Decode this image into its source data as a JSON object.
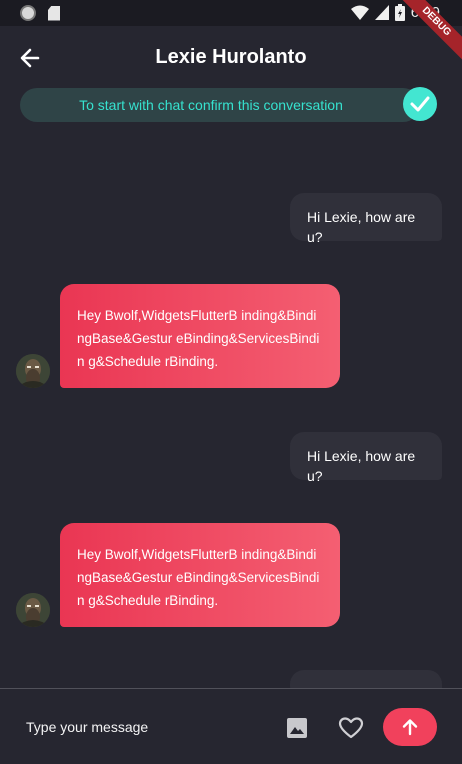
{
  "status_bar": {
    "time": "6:09"
  },
  "debug_banner": "DEBUG",
  "header": {
    "title": "Lexie Hurolanto"
  },
  "confirm_banner": {
    "text": "To start with chat confirm this conversation"
  },
  "messages": [
    {
      "direction": "outgoing",
      "text": "Hi Lexie, how are u?"
    },
    {
      "direction": "incoming",
      "text": "Hey Bwolf,WidgetsFlutterB inding&BindingBase&Gestur eBinding&ServicesBindin g&Schedule rBinding."
    },
    {
      "direction": "outgoing",
      "text": "Hi Lexie, how are u?"
    },
    {
      "direction": "incoming",
      "text": "Hey Bwolf,WidgetsFlutterB inding&BindingBase&Gestur eBinding&ServicesBindin g&Schedule rBinding."
    }
  ],
  "composer": {
    "placeholder": "Type your message"
  },
  "colors": {
    "background": "#262630",
    "outgoing_bubble": "#30303a",
    "incoming_gradient_start": "#ea3653",
    "incoming_gradient_end": "#f45f72",
    "accent_teal": "#43e6d1",
    "send_button": "#f1415c"
  },
  "icons": {
    "back": "arrow-left-icon",
    "confirm": "check-icon",
    "image": "image-icon",
    "like": "heart-outline-icon",
    "send": "arrow-up-icon"
  }
}
